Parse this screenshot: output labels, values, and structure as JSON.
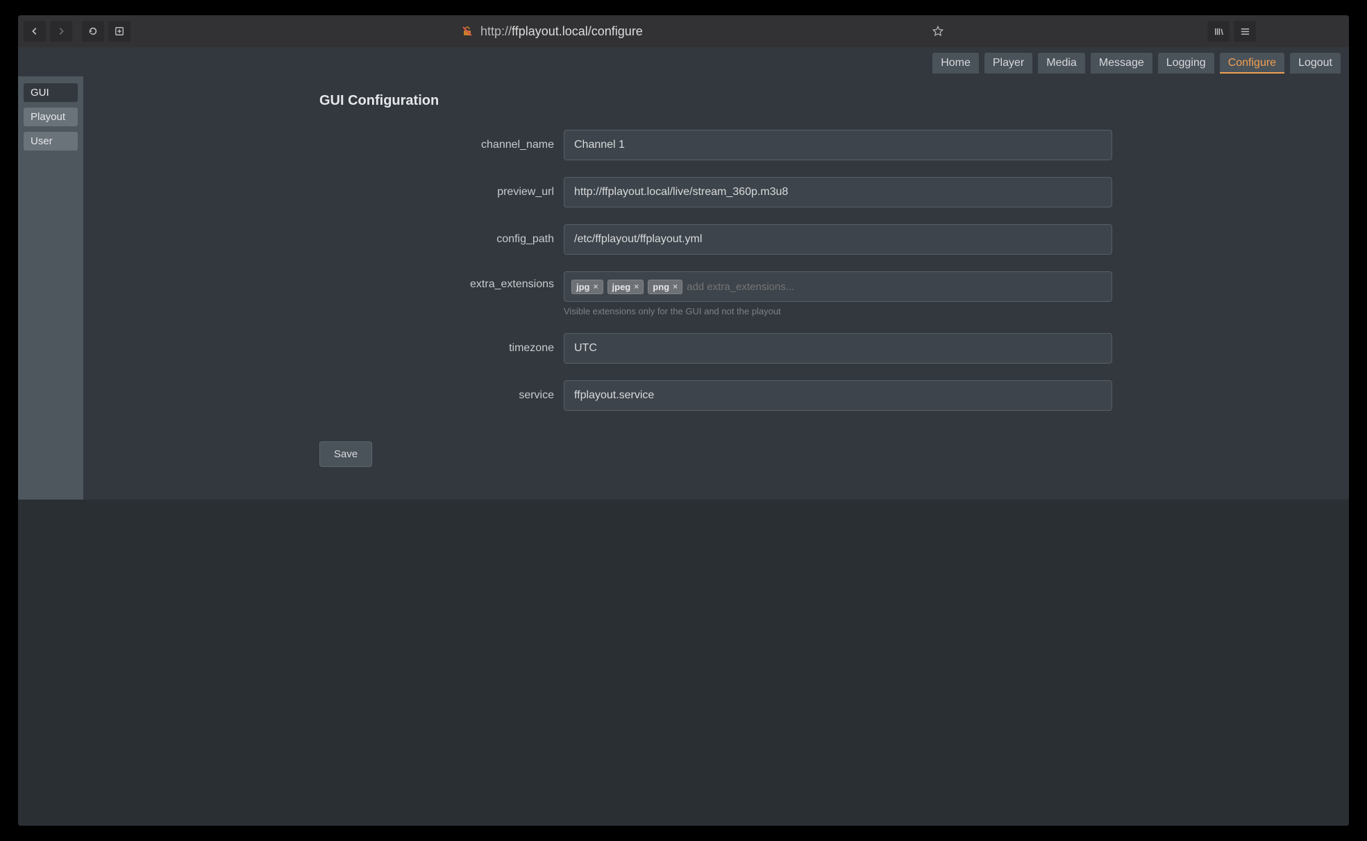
{
  "browser": {
    "url_proto": "http://",
    "url_rest": "ffplayout.local/configure"
  },
  "nav": {
    "tabs": [
      "Home",
      "Player",
      "Media",
      "Message",
      "Logging",
      "Configure",
      "Logout"
    ],
    "active": "Configure"
  },
  "sidebar": {
    "tabs": [
      "GUI",
      "Playout",
      "User"
    ],
    "active": "GUI"
  },
  "page": {
    "title": "GUI Configuration"
  },
  "form": {
    "labels": {
      "channel_name": "channel_name",
      "preview_url": "preview_url",
      "config_path": "config_path",
      "extra_extensions": "extra_extensions",
      "timezone": "timezone",
      "service": "service"
    },
    "values": {
      "channel_name": "Channel 1",
      "preview_url": "http://ffplayout.local/live/stream_360p.m3u8",
      "config_path": "/etc/ffplayout/ffplayout.yml",
      "timezone": "UTC",
      "service": "ffplayout.service"
    },
    "extra_extensions_tags": [
      "jpg",
      "jpeg",
      "png"
    ],
    "extra_extensions_placeholder": "add extra_extensions...",
    "extra_extensions_help": "Visible extensions only for the GUI and not the playout"
  },
  "buttons": {
    "save": "Save"
  }
}
